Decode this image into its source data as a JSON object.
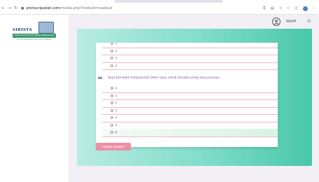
{
  "browser": {
    "lock_icon": "lock-icon",
    "url_host": "prensuripadati.com",
    "url_path": "/media.php?module=soalquiz"
  },
  "sidebar": {
    "logo_title": "SIBISTA",
    "logo_band": "Sistem Pre-Sinnal Pendidikan Keterampilan",
    "logo_sub": "Pondok Pesantren Darul Ulum Wasath"
  },
  "header": {
    "user_name": "NAIM"
  },
  "form": {
    "top_options": [
      "1",
      "2",
      "3",
      "4"
    ],
    "question": {
      "number": "60.",
      "text": "Saya bersedia menjulurkan leher saya untuk sesuatu yang saya percaya"
    },
    "options": [
      "0",
      "1",
      "2",
      "3",
      "4",
      "5",
      "6"
    ],
    "selected_option": "6",
    "save_label": "Simpan Jawaban"
  },
  "colors": {
    "accent_teal": "#49c7a8",
    "save_button": "#ef8fa2",
    "question_text": "#7a4a9a",
    "row_divider": "#f2b7c4"
  }
}
